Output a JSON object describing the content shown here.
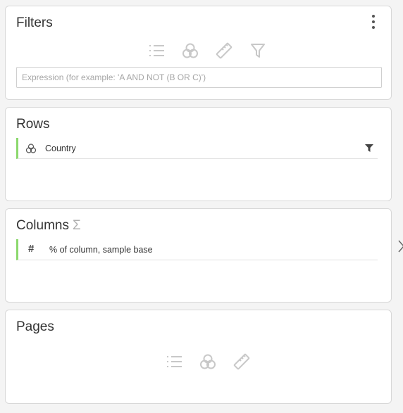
{
  "filters": {
    "title": "Filters",
    "expression_placeholder": "Expression (for example: 'A AND NOT (B OR C)')",
    "expression_value": "",
    "toolbar_icons": [
      "list-icon",
      "venn-icon",
      "ruler-icon",
      "funnel-icon"
    ]
  },
  "rows": {
    "title": "Rows",
    "items": [
      {
        "label": "Country",
        "icon": "venn-icon"
      }
    ]
  },
  "columns": {
    "title": "Columns",
    "sigma": "Σ",
    "items": [
      {
        "label": "% of column, sample base",
        "icon": "#"
      }
    ]
  },
  "pages": {
    "title": "Pages",
    "toolbar_icons": [
      "list-icon",
      "venn-icon",
      "ruler-icon"
    ]
  },
  "colors": {
    "accent_green": "#8bd86d",
    "icon_gray": "#c8c8c8",
    "border": "#d8d8d8",
    "background": "#f4f4f4"
  }
}
